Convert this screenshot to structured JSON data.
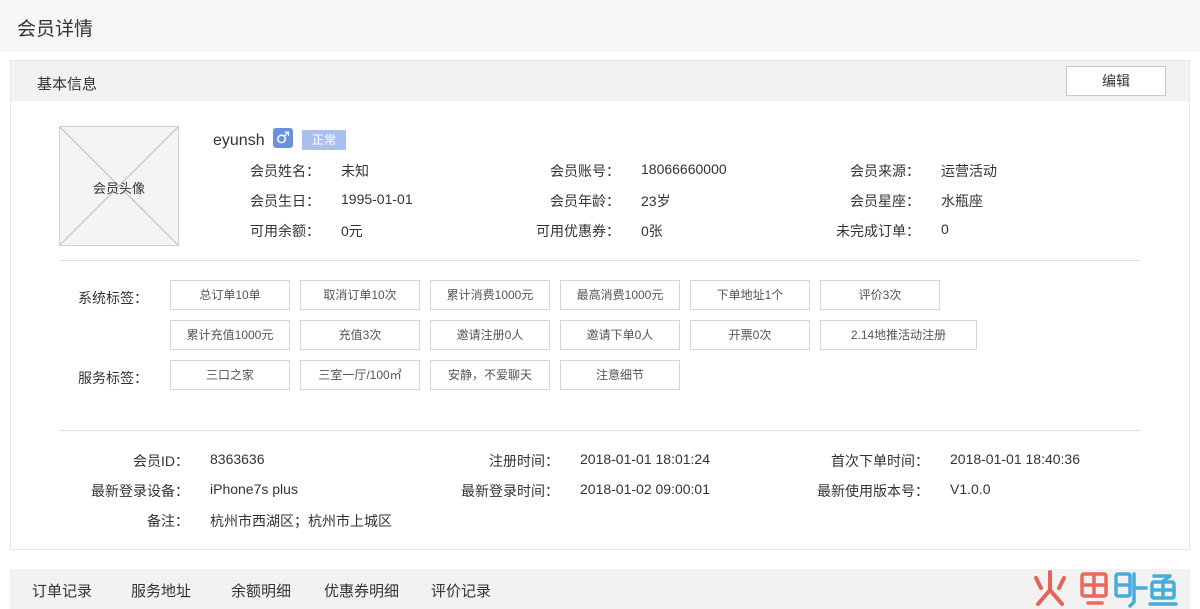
{
  "page": {
    "title": "会员详情"
  },
  "panel": {
    "title": "基本信息",
    "edit_label": "编辑"
  },
  "profile": {
    "avatar_label": "会员头像",
    "username": "eyunsh",
    "gender_symbol": "♂",
    "status": "正常",
    "rows": [
      {
        "label": "会员姓名：",
        "value": "未知"
      },
      {
        "label": "会员账号：",
        "value": "18066660000"
      },
      {
        "label": "会员来源：",
        "value": "运营活动"
      },
      {
        "label": "会员生日：",
        "value": "1995-01-01"
      },
      {
        "label": "会员年龄：",
        "value": "23岁"
      },
      {
        "label": "会员星座：",
        "value": "水瓶座"
      },
      {
        "label": "可用余额：",
        "value": "0元"
      },
      {
        "label": "可用优惠券：",
        "value": "0张"
      },
      {
        "label": "未完成订单：",
        "value": "0"
      }
    ]
  },
  "tags": {
    "system_label": "系统标签：",
    "system": [
      "总订单10单",
      "取消订单10次",
      "累计消费1000元",
      "最高消费1000元",
      "下单地址1个",
      "评价3次",
      "累计充值1000元",
      "充值3次",
      "邀请注册0人",
      "邀请下单0人",
      "开票0次",
      "2.14地推活动注册"
    ],
    "service_label": "服务标签：",
    "service": [
      "三口之家",
      "三室一厅/100㎡",
      "安静，不爱聊天",
      "注意细节"
    ]
  },
  "meta": [
    {
      "label": "会员ID：",
      "value": "8363636"
    },
    {
      "label": "注册时间：",
      "value": "2018-01-01 18:01:24"
    },
    {
      "label": "首次下单时间：",
      "value": "2018-01-01 18:40:36"
    },
    {
      "label": "最新登录设备：",
      "value": "iPhone7s plus"
    },
    {
      "label": "最新登录时间：",
      "value": "2018-01-02 09:00:01"
    },
    {
      "label": "最新使用版本号：",
      "value": "V1.0.0"
    },
    {
      "label": "备注：",
      "value": "杭州市西湖区；杭州市上城区"
    }
  ],
  "tabs": [
    "订单记录",
    "服务地址",
    "余额明细",
    "优惠券明细",
    "评价记录"
  ],
  "colors": {
    "accent": "#6c8fde",
    "badge": "#a9c0ef",
    "watermark": "#e8473a"
  }
}
